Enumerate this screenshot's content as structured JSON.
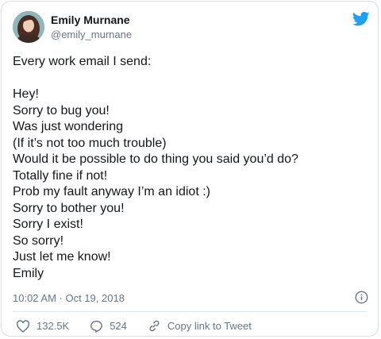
{
  "author": {
    "name": "Emily Murnane",
    "handle": "@emily_murnane"
  },
  "tweet": {
    "lines": [
      "Every work email I send:",
      "",
      "Hey!",
      "Sorry to bug you!",
      "Was just wondering",
      "(If it’s not too much trouble)",
      "Would it be possible to do thing you said you’d do?",
      "Totally fine if not!",
      "Prob my fault anyway I’m an idiot :)",
      "Sorry to bother you!",
      "Sorry I exist!",
      "So sorry!",
      "Just let me know!",
      "Emily"
    ],
    "timestamp": "10:02 AM · Oct 19, 2018"
  },
  "actions": {
    "likes": "132.5K",
    "replies": "524",
    "copy_link": "Copy link to Tweet"
  },
  "icons": [
    "twitter-bird-icon",
    "info-icon",
    "heart-icon",
    "reply-icon",
    "link-icon"
  ],
  "colors": {
    "brand": "#1da1f2",
    "muted": "#657786",
    "text": "#14171a"
  }
}
